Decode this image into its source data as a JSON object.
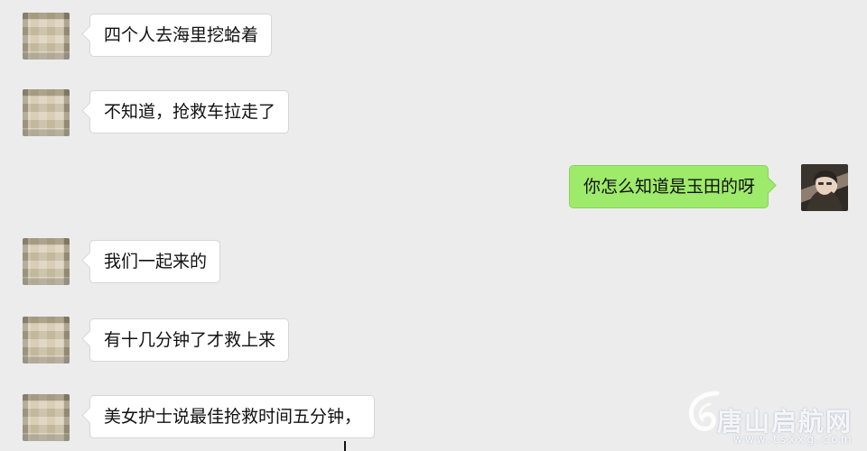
{
  "messages": [
    {
      "side": "left",
      "text": "四个人去海里挖蛤着"
    },
    {
      "side": "left",
      "text": "不知道，抢救车拉走了"
    },
    {
      "side": "right",
      "text": "你怎么知道是玉田的呀"
    },
    {
      "side": "left",
      "text": "我们一起来的"
    },
    {
      "side": "left",
      "text": "有十几分钟了才救上来"
    },
    {
      "side": "left",
      "text": "美女护士说最佳抢救时间五分钟，"
    }
  ],
  "watermark": {
    "brand": "唐山启航网",
    "url": "www.tsxxg.com"
  },
  "colors": {
    "background": "#ececec",
    "incoming_bubble": "#ffffff",
    "outgoing_bubble": "#9eea6a"
  },
  "icons": {
    "watermark_logo": "swirl-logo-icon"
  }
}
